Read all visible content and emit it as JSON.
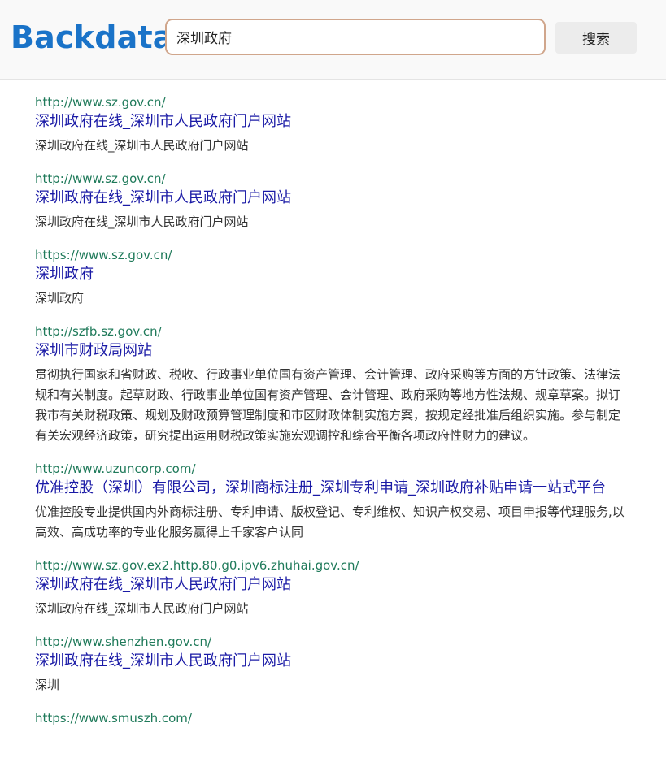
{
  "header": {
    "logo": "Backdata",
    "search_value": "深圳政府",
    "search_button": "搜索"
  },
  "results": [
    {
      "url": "http://www.sz.gov.cn/",
      "title": "深圳政府在线_深圳市人民政府门户网站",
      "desc": "深圳政府在线_深圳市人民政府门户网站"
    },
    {
      "url": "http://www.sz.gov.cn/",
      "title": "深圳政府在线_深圳市人民政府门户网站",
      "desc": "深圳政府在线_深圳市人民政府门户网站"
    },
    {
      "url": "https://www.sz.gov.cn/",
      "title": "深圳政府",
      "desc": "深圳政府"
    },
    {
      "url": "http://szfb.sz.gov.cn/",
      "title": "深圳市财政局网站",
      "desc": "贯彻执行国家和省财政、税收、行政事业单位国有资产管理、会计管理、政府采购等方面的方针政策、法律法规和有关制度。起草财政、行政事业单位国有资产管理、会计管理、政府采购等地方性法规、规章草案。拟订我市有关财税政策、规划及财政预算管理制度和市区财政体制实施方案，按规定经批准后组织实施。参与制定有关宏观经济政策，研究提出运用财税政策实施宏观调控和综合平衡各项政府性财力的建议。"
    },
    {
      "url": "http://www.uzuncorp.com/",
      "title": "优准控股（深圳）有限公司，深圳商标注册_深圳专利申请_深圳政府补贴申请一站式平台",
      "desc": "优准控股专业提供国内外商标注册、专利申请、版权登记、专利维权、知识产权交易、项目申报等代理服务,以高效、高成功率的专业化服务赢得上千家客户认同"
    },
    {
      "url": "http://www.sz.gov.ex2.http.80.g0.ipv6.zhuhai.gov.cn/",
      "title": "深圳政府在线_深圳市人民政府门户网站",
      "desc": "深圳政府在线_深圳市人民政府门户网站"
    },
    {
      "url": "http://www.shenzhen.gov.cn/",
      "title": "深圳政府在线_深圳市人民政府门户网站",
      "desc": "深圳"
    },
    {
      "url": "https://www.smuszh.com/",
      "title": "",
      "desc": ""
    }
  ]
}
